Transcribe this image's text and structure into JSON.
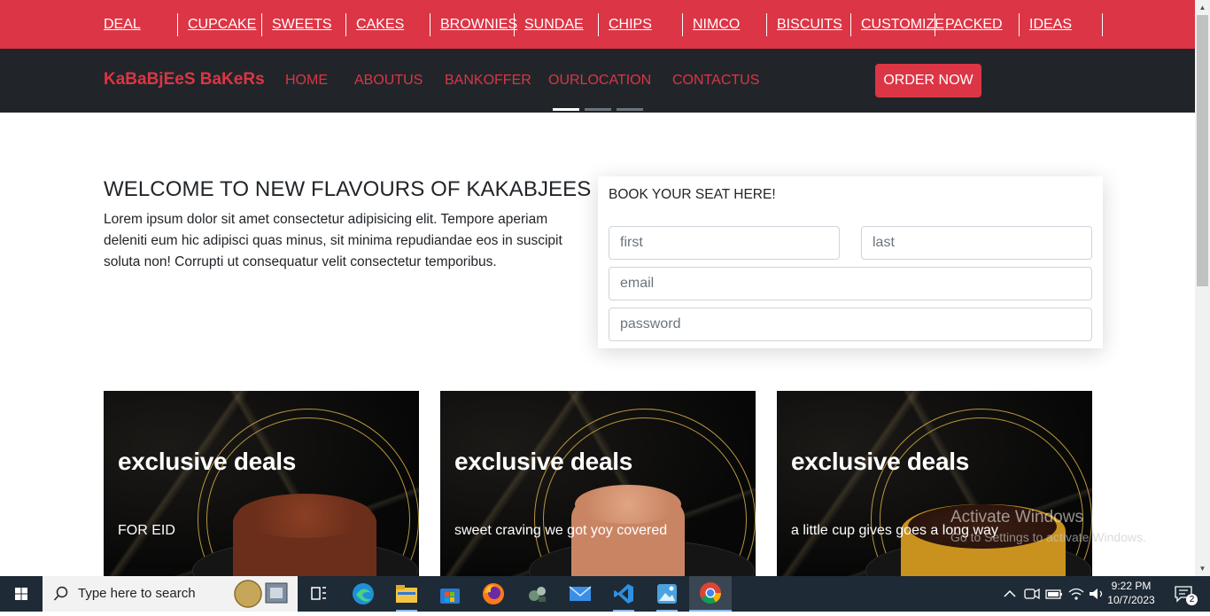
{
  "categories": [
    "DEAL",
    "CUPCAKE",
    "SWEETS",
    "CAKES",
    "BROWNIES",
    "SUNDAE",
    "CHIPS",
    "NIMCO",
    "BISCUITS",
    "CUSTOMIZE",
    "PACKED",
    "IDEAS"
  ],
  "nav": {
    "brand": "KaBaBjEeS BaKeRs",
    "links": [
      "HOME",
      "ABOUTUS",
      "BANKOFFER",
      "OURLOCATION",
      "CONTACTUS"
    ],
    "order_button": "ORDER NOW"
  },
  "welcome": {
    "title": "WELCOME TO NEW FLAVOURS OF KAKABJEES",
    "text": "Lorem ipsum dolor sit amet consectetur adipisicing elit. Tempore aperiam deleniti eum hic adipisci quas minus, sit minima repudiandae eos in suscipit soluta non! Corrupti ut consequatur velit consectetur temporibus."
  },
  "booking": {
    "title": "BOOK YOUR SEAT HERE!",
    "first_placeholder": "first",
    "last_placeholder": "last",
    "email_placeholder": "email",
    "password_placeholder": "password"
  },
  "promos": [
    {
      "title": "exclusive deals",
      "subtitle": "FOR EID"
    },
    {
      "title": "exclusive deals",
      "subtitle": "sweet craving we got yoy covered"
    },
    {
      "title": "exclusive deals",
      "subtitle": "a little cup gives goes a long way"
    }
  ],
  "watermark": {
    "line1": "Activate Windows",
    "line2": "Go to Settings to activate Windows."
  },
  "taskbar": {
    "search_placeholder": "Type here to search",
    "time": "9:22 PM",
    "date": "10/7/2023",
    "notification_count": "2"
  },
  "colors": {
    "accent": "#dc3545",
    "navbar": "#212529"
  }
}
